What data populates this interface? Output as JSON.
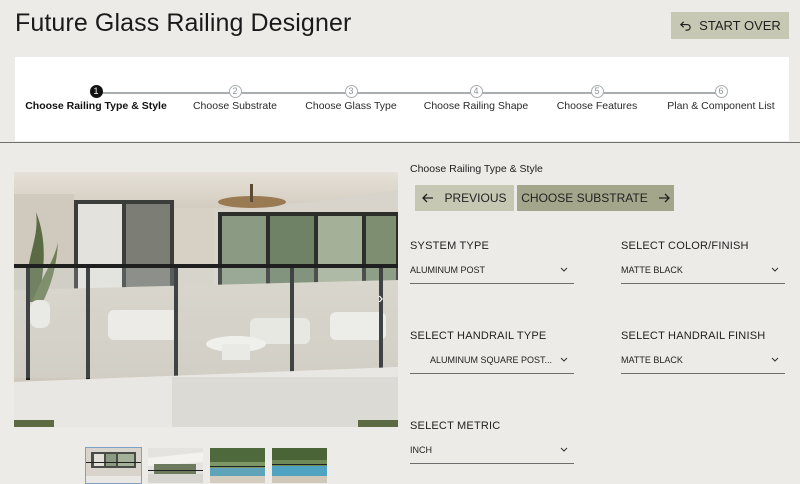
{
  "app": {
    "title": "Future Glass Railing Designer",
    "start_over_label": "START OVER"
  },
  "stepper": {
    "steps": [
      {
        "number": "1",
        "label": "Choose Railing Type & Style",
        "active": true
      },
      {
        "number": "2",
        "label": "Choose Substrate",
        "active": false
      },
      {
        "number": "3",
        "label": "Choose Glass Type",
        "active": false
      },
      {
        "number": "4",
        "label": "Choose Railing Shape",
        "active": false
      },
      {
        "number": "5",
        "label": "Choose Features",
        "active": false
      },
      {
        "number": "6",
        "label": "Plan & Component List",
        "active": false
      }
    ]
  },
  "gallery": {
    "next_glyph": "›",
    "thumbnail_count": 4,
    "active_thumbnail": 1
  },
  "panel": {
    "section_label": "Choose Railing Type & Style",
    "previous_label": "PREVIOUS",
    "next_label": "CHOOSE SUBSTRATE",
    "fields": {
      "system_type": {
        "label": "SYSTEM TYPE",
        "value": "ALUMINUM POST"
      },
      "color_finish": {
        "label": "SELECT COLOR/FINISH",
        "value": "MATTE BLACK"
      },
      "handrail_type": {
        "label": "SELECT HANDRAIL TYPE",
        "value": "ALUMINUM SQUARE POST..."
      },
      "handrail_finish": {
        "label": "SELECT HANDRAIL FINISH",
        "value": "MATTE BLACK"
      },
      "metric": {
        "label": "SELECT METRIC",
        "value": "INCH"
      }
    }
  },
  "colors": {
    "background": "#ecebe7",
    "start_over_bg": "#c7c8b3",
    "previous_bg": "#c7c8b3",
    "next_bg": "#a4a68b",
    "step_active": "#111111",
    "step_inactive": "#a8adb0"
  },
  "icons": {
    "start_over": "undo-arrow-icon",
    "previous": "arrow-left-icon",
    "next": "arrow-right-icon",
    "dropdown": "chevron-down-icon",
    "gallery_next": "chevron-right-icon"
  }
}
